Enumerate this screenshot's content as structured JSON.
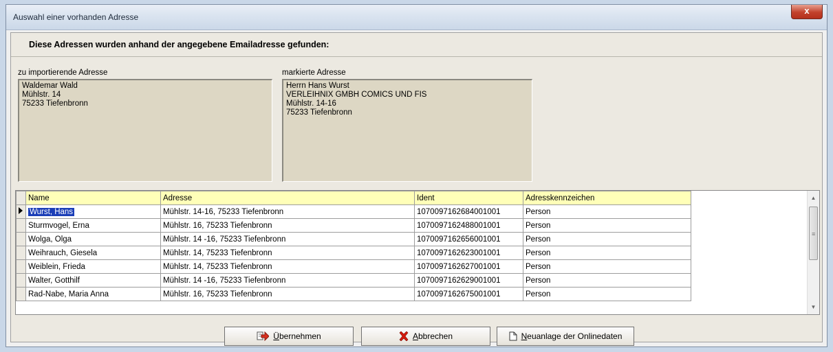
{
  "window": {
    "title": "Auswahl einer vorhanden Adresse",
    "close_label": "x"
  },
  "heading": "Diese Adressen wurden anhand der angegebene Emailadresse gefunden:",
  "import_address": {
    "label": "zu importierende Adresse",
    "text": "Waldemar Wald\nMühlstr. 14\n75233 Tiefenbronn"
  },
  "marked_address": {
    "label": "markierte Adresse",
    "text": "Herrn Hans Wurst\nVERLEIHNIX GMBH COMICS UND FIS\nMühlstr. 14-16\n75233 Tiefenbronn"
  },
  "table": {
    "columns": [
      "Name",
      "Adresse",
      "Ident",
      "Adresskennzeichen"
    ],
    "rows": [
      {
        "name": "Wurst, Hans",
        "address": "Mühlstr. 14-16, 75233 Tiefenbronn",
        "ident": "1070097162684001001",
        "type": "Person",
        "selected": true
      },
      {
        "name": "Sturmvogel, Erna",
        "address": "Mühlstr. 16, 75233 Tiefenbronn",
        "ident": "1070097162488001001",
        "type": "Person"
      },
      {
        "name": "Wolga, Olga",
        "address": "Mühlstr. 14 -16, 75233 Tiefenbronn",
        "ident": "1070097162656001001",
        "type": "Person"
      },
      {
        "name": "Weihrauch, Giesela",
        "address": "Mühlstr. 14, 75233 Tiefenbronn",
        "ident": "1070097162623001001",
        "type": "Person"
      },
      {
        "name": "Weiblein, Frieda",
        "address": "Mühlstr. 14, 75233 Tiefenbronn",
        "ident": "1070097162627001001",
        "type": "Person"
      },
      {
        "name": "Walter, Gotthilf",
        "address": "Mühlstr. 14 -16, 75233 Tiefenbronn",
        "ident": "1070097162629001001",
        "type": "Person"
      },
      {
        "name": "Rad-Nabe, Maria Anna",
        "address": "Mühlstr. 16, 75233 Tiefenbronn",
        "ident": "1070097162675001001",
        "type": "Person"
      }
    ]
  },
  "buttons": {
    "accept": {
      "accel": "Ü",
      "rest": "bernehmen",
      "icon": "accept-arrow-icon"
    },
    "cancel": {
      "accel": "A",
      "rest": "bbrechen",
      "icon": "red-x-icon"
    },
    "new_online": {
      "accel": "N",
      "rest": "euanlage der Onlinedaten",
      "icon": "new-document-icon"
    }
  },
  "colors": {
    "header_bg": "#ffffb8",
    "address_box_bg": "#ddd7c4",
    "selection_bg": "#1b3eb7",
    "close_button": "#c2422c"
  }
}
